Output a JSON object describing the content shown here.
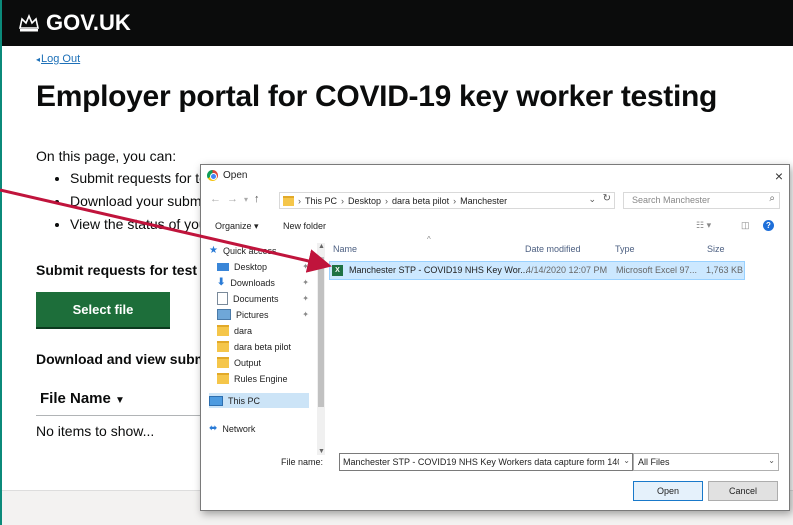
{
  "gov_header": {
    "logo_text": "GOV.UK"
  },
  "logout_link": "Log Out",
  "page_title": "Employer portal for COVID-19 key worker testing",
  "intro": "On this page, you can:",
  "bullets": [
    "Submit requests for te",
    "Download your submi",
    "View the status of you"
  ],
  "section_submit": "Submit requests for test c",
  "select_file_button": "Select file",
  "section_download": "Download and view submi",
  "table": {
    "column": "File Name",
    "empty_text": "No items to show..."
  },
  "dialog": {
    "title": "Open",
    "close": "×",
    "address": {
      "crumbs": [
        "This PC",
        "Desktop",
        "dara beta pilot",
        "Manchester"
      ]
    },
    "search_placeholder": "Search Manchester",
    "toolbar": {
      "organize": "Organize ▾",
      "new_folder": "New folder"
    },
    "nav_items": [
      {
        "label": "Quick access",
        "icon": "star-icon"
      },
      {
        "label": "Desktop",
        "icon": "desktop-icon",
        "pinned": true
      },
      {
        "label": "Downloads",
        "icon": "download-icon",
        "pinned": true
      },
      {
        "label": "Documents",
        "icon": "document-icon",
        "pinned": true
      },
      {
        "label": "Pictures",
        "icon": "pictures-icon",
        "pinned": true
      },
      {
        "label": "dara",
        "icon": "folder-icon"
      },
      {
        "label": "dara beta pilot",
        "icon": "folder-icon"
      },
      {
        "label": "Output",
        "icon": "folder-icon"
      },
      {
        "label": "Rules Engine",
        "icon": "folder-icon"
      },
      {
        "label": "This PC",
        "icon": "computer-icon",
        "selected": true
      },
      {
        "label": "Network",
        "icon": "network-icon"
      }
    ],
    "columns": {
      "name": "Name",
      "date": "Date modified",
      "type": "Type",
      "size": "Size"
    },
    "files": [
      {
        "name": "Manchester STP - COVID19 NHS Key Wor...",
        "date": "4/14/2020 12:07 PM",
        "type": "Microsoft Excel 97...",
        "size": "1,763 KB"
      }
    ],
    "file_name_label": "File name:",
    "file_name_value": "Manchester STP - COVID19 NHS Key Workers data capture form 1404",
    "file_type": "All Files",
    "open_button": "Open",
    "cancel_button": "Cancel"
  },
  "colors": {
    "header_bg": "#0b0c0c",
    "link": "#1d70b8",
    "button_green": "#1d6e3a",
    "annotation_arrow": "#c0143c",
    "selection": "#cce8ff"
  }
}
